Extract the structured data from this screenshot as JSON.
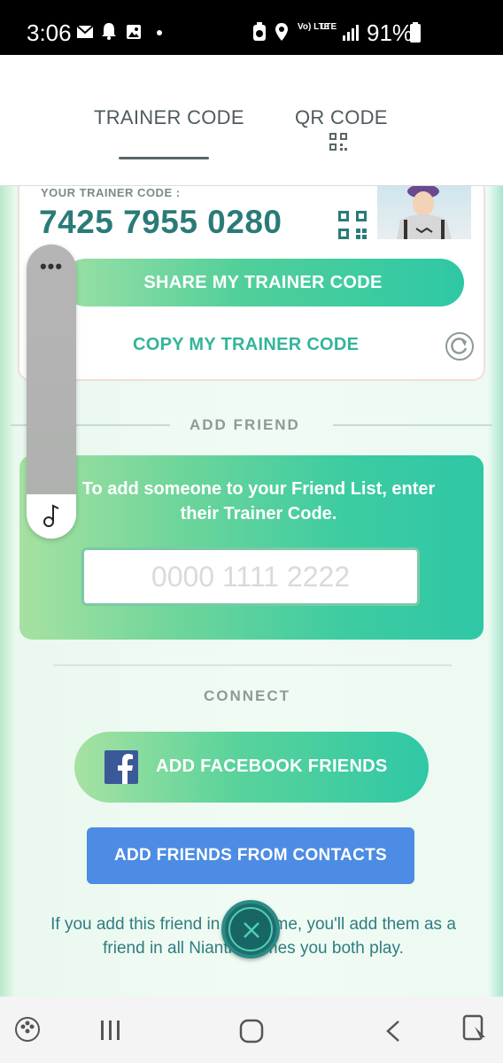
{
  "status_bar": {
    "time": "3:06",
    "network_label": "Vo) LTE",
    "lte_label": "LTE",
    "battery": "91%"
  },
  "tabs": [
    {
      "label": "TRAINER CODE",
      "active": true
    },
    {
      "label": "QR CODE",
      "active": false
    }
  ],
  "trainer_card": {
    "label": "YOUR TRAINER CODE :",
    "code": "7425 7955 0280",
    "share_label": "SHARE MY TRAINER CODE",
    "copy_label": "COPY MY TRAINER CODE"
  },
  "add_friend": {
    "title": "ADD FRIEND",
    "instructions": "To add someone to your Friend List, enter their Trainer Code.",
    "input_placeholder": "0000 1111 2222"
  },
  "connect": {
    "title": "CONNECT",
    "facebook_label": "ADD FACEBOOK FRIENDS",
    "contacts_label": "ADD FRIENDS FROM CONTACTS",
    "info_text": "If you add this friend in this game, you'll add them as a friend in all Niantic games you both play."
  },
  "side_panel": {
    "dots": "•••"
  },
  "colors": {
    "code_teal": "#2a7b78",
    "contacts_blue": "#4c8ce4",
    "facebook_blue": "#3b5998",
    "green_gradient_end": "#2fc7a6"
  },
  "icons": [
    "mail-icon",
    "bell-icon",
    "image-icon",
    "location-icon",
    "signal-icon",
    "battery-icon",
    "qr-icon",
    "refresh-icon",
    "facebook-icon",
    "close-icon",
    "music-note-icon",
    "game-launcher-icon",
    "recent-apps-icon",
    "home-icon",
    "back-icon",
    "screenshot-icon"
  ]
}
